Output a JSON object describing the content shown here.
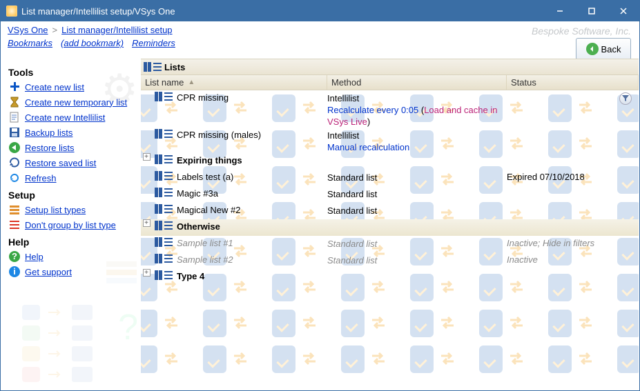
{
  "titlebar": {
    "text": "List manager/Intellilist setup/VSys One"
  },
  "breadcrumb": {
    "root": "VSys One",
    "current": "List manager/Intellilist setup"
  },
  "topnav": {
    "bookmarks": "Bookmarks",
    "add_bookmark": "(add bookmark)",
    "reminders": "Reminders"
  },
  "branding": "Bespoke Software, Inc.",
  "back_label": "Back",
  "sidebar": {
    "tools_title": "Tools",
    "setup_title": "Setup",
    "help_title": "Help",
    "items": {
      "create_new_list": "Create new list",
      "create_new_temporary_list": "Create new temporary list",
      "create_new_intellilist": "Create new Intellilist",
      "backup_lists": "Backup lists",
      "restore_lists": "Restore lists",
      "restore_saved_list": "Restore saved list",
      "refresh": "Refresh",
      "setup_list_types": "Setup list types",
      "dont_group_by_list_type": "Don't group by list type",
      "help": "Help",
      "get_support": "Get support"
    }
  },
  "panel": {
    "title": "Lists",
    "columns": {
      "name": "List name",
      "method": "Method",
      "status": "Status"
    },
    "rows": [
      {
        "name": "CPR missing",
        "method_line1": "Intellilist",
        "method_line2a": "Recalculate every 0:05",
        "method_line2b": " (",
        "method_line2c": "Load and cache in VSys Live",
        "method_line2d": ")",
        "status": "",
        "inactive": false,
        "bold": false,
        "group": false,
        "has_filter": true
      },
      {
        "name": "CPR missing (males)",
        "method_line1": "Intellilist",
        "method_line2a": "Manual recalculation",
        "status": "",
        "inactive": false,
        "bold": false,
        "group": false
      },
      {
        "name": "Expiring things",
        "group": true
      },
      {
        "name": "Labels test (a)",
        "method_line1": "Standard list",
        "status": "Expired 07/10/2018"
      },
      {
        "name": "Magic #3a",
        "method_line1": "Standard list",
        "status": ""
      },
      {
        "name": "Magical New #2",
        "method_line1": "Standard list",
        "status": ""
      },
      {
        "name": "Otherwise",
        "group": true,
        "shade": true
      },
      {
        "name": "Sample list #1",
        "method_line1": "Standard list",
        "status": "Inactive; Hide in filters",
        "inactive": true
      },
      {
        "name": "Sample list #2",
        "method_line1": "Standard list",
        "status": "Inactive",
        "inactive": true
      },
      {
        "name": "Type 4",
        "group": true
      }
    ]
  }
}
